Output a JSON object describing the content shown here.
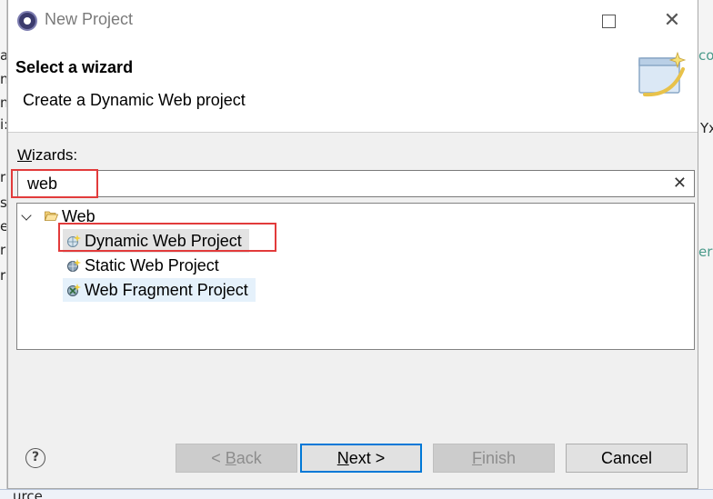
{
  "background": {
    "left_fragments": [
      "a",
      "n",
      "n",
      "i:",
      "r",
      "s",
      "el",
      "r",
      "r"
    ],
    "right_fragments": [
      "co",
      "Yx",
      "er"
    ],
    "bottom_fragment": "urce"
  },
  "window": {
    "title": "New Project",
    "maximize_glyph": "",
    "close_glyph": "✕"
  },
  "header": {
    "title": "Select a wizard",
    "description": "Create a Dynamic Web project"
  },
  "wizards": {
    "label_first": "W",
    "label_rest": "izards:",
    "filter_value": "web",
    "clear_glyph": "✕",
    "category": "Web",
    "items": [
      {
        "label": "Dynamic Web Project"
      },
      {
        "label": "Static Web Project"
      },
      {
        "label": "Web Fragment Project"
      }
    ]
  },
  "buttons": {
    "help": "?",
    "back_prefix": "< ",
    "back_mnemonic": "B",
    "back_rest": "ack",
    "next_mnemonic": "N",
    "next_rest": "ext >",
    "finish_mnemonic": "F",
    "finish_rest": "inish",
    "cancel": "Cancel"
  },
  "colors": {
    "highlight": "#e23b3b",
    "focus_border": "#0078d7",
    "selection": "#e3e3e3"
  }
}
